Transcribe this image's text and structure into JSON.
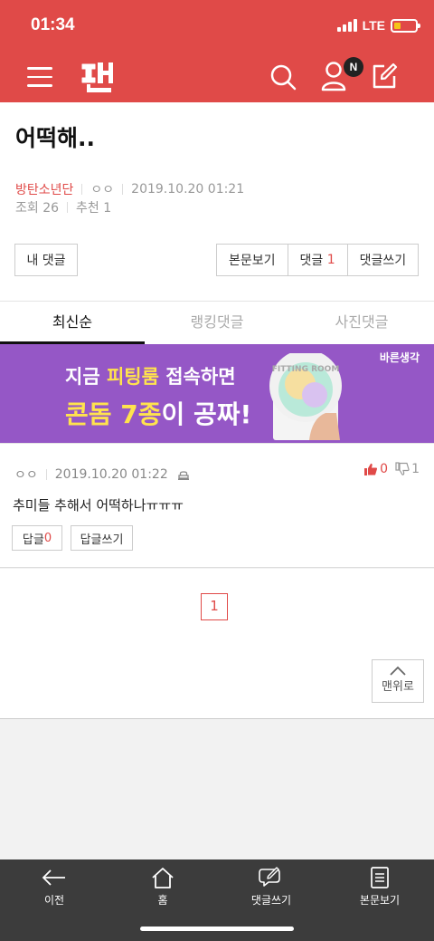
{
  "status": {
    "time": "01:34",
    "network": "LTE"
  },
  "header": {
    "notification_badge": "N",
    "brand_color": "#e04a48"
  },
  "article": {
    "title": "어떡해..",
    "category": "방탄소년단",
    "author": "ㅇㅇ",
    "date": "2019.10.20 01:21",
    "views_label": "조회 26",
    "recommend_label": "추천 1",
    "my_comments_label": "내 댓글",
    "view_post_label": "본문보기",
    "comments_label": "댓글",
    "comments_count": "1",
    "write_comment_label": "댓글쓰기"
  },
  "tabs": [
    {
      "label": "최신순",
      "active": true
    },
    {
      "label": "랭킹댓글",
      "active": false
    },
    {
      "label": "사진댓글",
      "active": false
    }
  ],
  "banner": {
    "line1_prefix": "지금 ",
    "line1_highlight": "피팅룸",
    "line1_suffix": " 접속하면",
    "line2_highlight": "콘돔 7종",
    "line2_suffix": "이 공짜!",
    "brand": "바른생각",
    "product_text": "FITTING ROOM"
  },
  "comment": {
    "author": "ㅇㅇ",
    "date": "2019.10.20 01:22",
    "likes": "0",
    "dislikes": "1",
    "body": "추미들 추해서 어떡하나ㅠㅠㅠ",
    "reply_label": "답글",
    "reply_count": "0",
    "write_reply_label": "답글쓰기"
  },
  "pagination": {
    "current_page": "1",
    "to_top_label": "맨위로"
  },
  "bottom_nav": {
    "back_label": "이전",
    "home_label": "홈",
    "write_comment_label": "댓글쓰기",
    "view_post_label": "본문보기"
  }
}
